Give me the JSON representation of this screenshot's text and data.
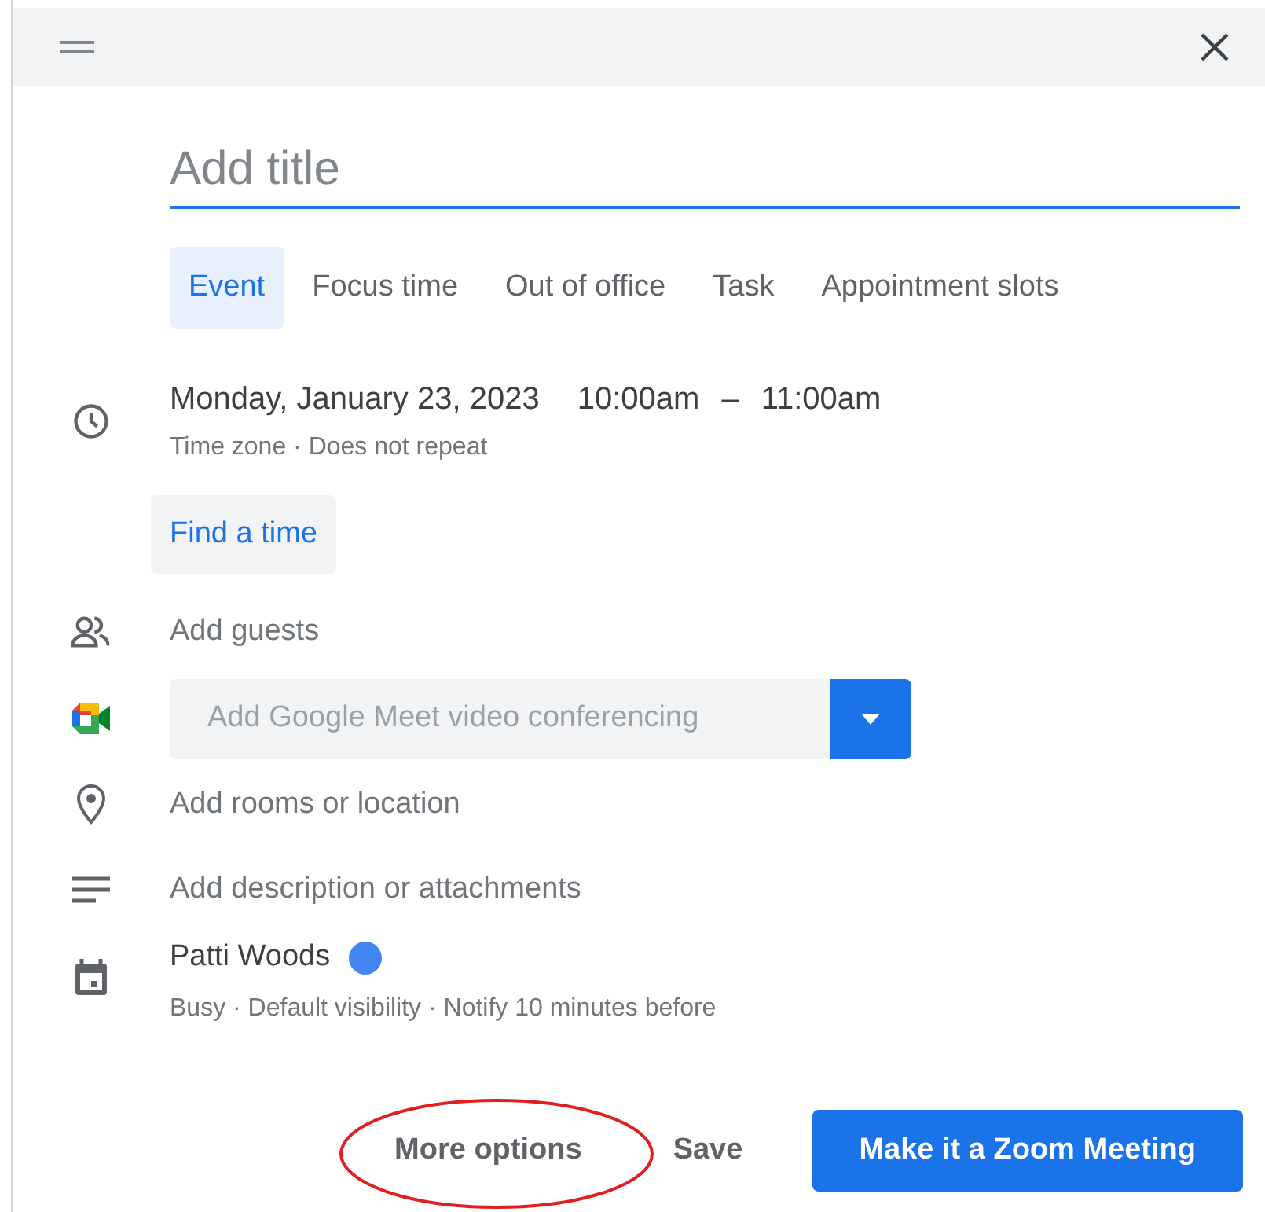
{
  "dialog": {
    "title_field": {
      "placeholder": "Add title"
    },
    "tabs": [
      {
        "label": "Event",
        "selected": true
      },
      {
        "label": "Focus time",
        "selected": false
      },
      {
        "label": "Out of office",
        "selected": false
      },
      {
        "label": "Task",
        "selected": false
      },
      {
        "label": "Appointment slots",
        "selected": false
      }
    ],
    "rows": [
      {
        "kind": "datetime",
        "date": "Monday, January 23, 2023",
        "start": "10:00am",
        "separator": "–",
        "end": "11:00am",
        "details": "Time zone · Does not repeat",
        "action": "Find a time"
      },
      {
        "kind": "guests",
        "label": "Add guests"
      },
      {
        "kind": "meet",
        "label": "Add Google Meet video conferencing"
      },
      {
        "kind": "location",
        "label": "Add rooms or location"
      },
      {
        "kind": "description",
        "label": "Add description or attachments"
      },
      {
        "kind": "calendar",
        "name": "Patti Woods",
        "color": "#4285f4",
        "details": "Busy · Default visibility · Notify 10 minutes before"
      }
    ],
    "footer": {
      "buttons": [
        {
          "label": "More options",
          "kind": "text",
          "circled": true
        },
        {
          "label": "Save",
          "kind": "text",
          "circled": false
        },
        {
          "label": "Make it a Zoom Meeting",
          "kind": "primary",
          "circled": false
        }
      ]
    }
  }
}
